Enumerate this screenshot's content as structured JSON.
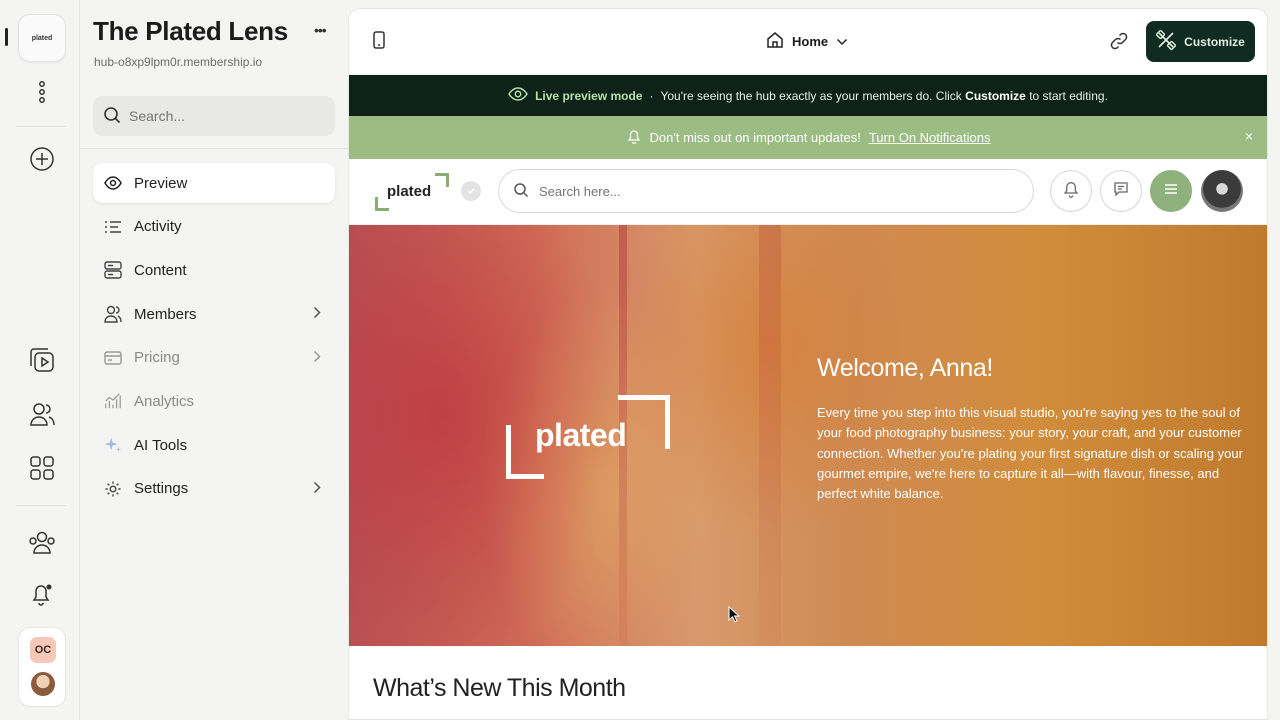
{
  "rail": {
    "logo_text": "plated"
  },
  "user_badge": "OC",
  "sidebar": {
    "hub_name": "The Plated Lens",
    "hub_more": "•••",
    "hub_url": "hub-o8xp9lpm0r.membership.io",
    "search_placeholder": "Search...",
    "items": [
      {
        "label": "Preview",
        "icon": "eye-icon",
        "active": true
      },
      {
        "label": "Activity",
        "icon": "activity-list-icon"
      },
      {
        "label": "Content",
        "icon": "content-stack-icon"
      },
      {
        "label": "Members",
        "icon": "members-icon",
        "has_submenu": true
      },
      {
        "label": "Pricing",
        "icon": "credit-card-icon",
        "has_submenu": true,
        "muted": true
      },
      {
        "label": "Analytics",
        "icon": "analytics-chart-icon",
        "muted": true
      },
      {
        "label": "AI Tools",
        "icon": "sparkle-icon"
      },
      {
        "label": "Settings",
        "icon": "gear-icon",
        "has_submenu": true
      }
    ]
  },
  "toolbar": {
    "page_label": "Home",
    "customize_label": "Customize"
  },
  "live_banner": {
    "mode_label": "Live preview mode",
    "separator": "·",
    "message_before": "You're seeing the hub exactly as your members do. Click",
    "message_bold": "Customize",
    "message_after": "to start editing."
  },
  "notification_banner": {
    "message": "Don't miss out on important updates!",
    "link_label": "Turn On Notifications",
    "close": "×"
  },
  "hub_header": {
    "brand": "plated",
    "search_placeholder": "Search here..."
  },
  "hero": {
    "logo_text": "plated",
    "title": "Welcome, Anna!",
    "body": "Every time you step into this visual studio, you're saying yes to the soul of your food photography business: your story, your craft, and your customer connection. Whether you're plating your first signature dish or scaling your gourmet empire, we're here to capture it all—with flavour, finesse, and perfect white balance."
  },
  "section": {
    "title": "What’s New This Month"
  },
  "colors": {
    "dark_green": "#0f2b22",
    "accent_green": "#8fb17c",
    "notification_green": "#9bbd84"
  }
}
